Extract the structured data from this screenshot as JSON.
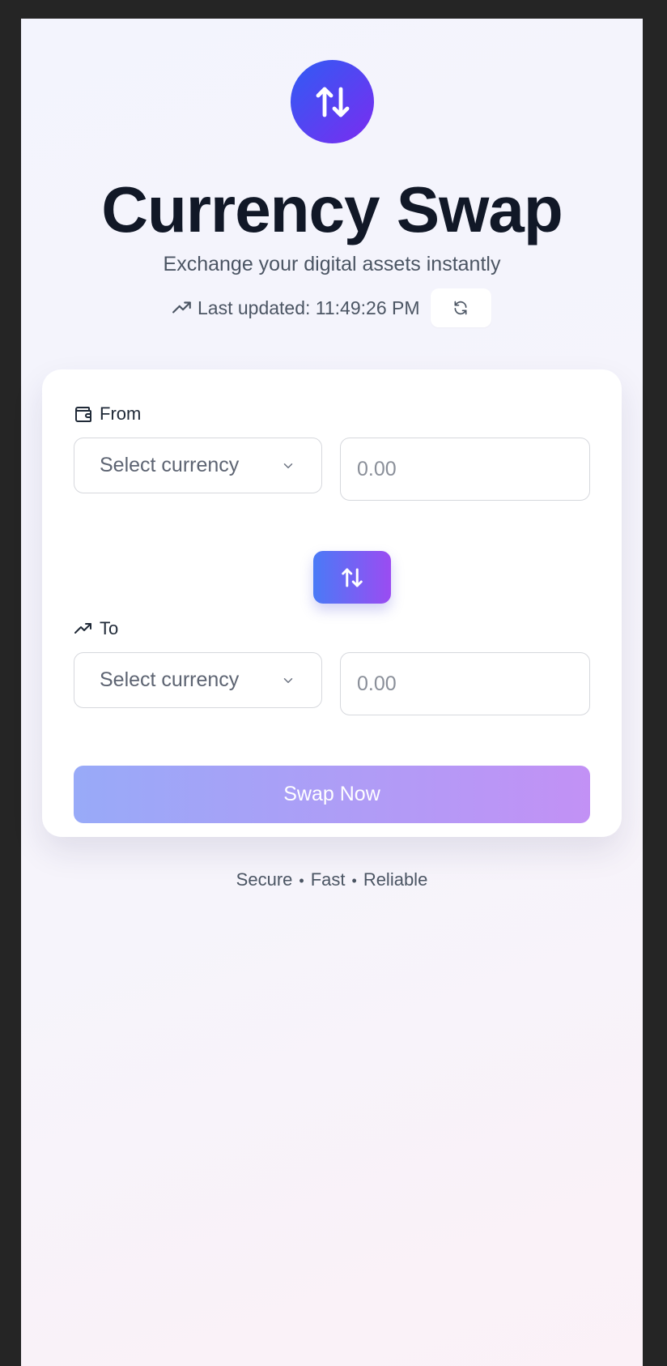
{
  "header": {
    "title": "Currency Swap",
    "subtitle": "Exchange your digital assets instantly",
    "last_updated": "Last updated: 11:49:26 PM"
  },
  "form": {
    "from": {
      "label": "From",
      "currency_select": "Select currency",
      "amount_placeholder": "0.00"
    },
    "to": {
      "label": "To",
      "currency_select": "Select currency",
      "amount_placeholder": "0.00"
    },
    "submit_label": "Swap Now"
  },
  "footer": {
    "tags": [
      "Secure",
      "Fast",
      "Reliable"
    ],
    "separator": "•"
  },
  "icons": {
    "logo": "arrow-up-down-icon",
    "last_updated": "trending-up-icon",
    "refresh": "refresh-icon",
    "from": "wallet-icon",
    "to": "trending-up-icon",
    "select": "chevron-down-icon",
    "direction": "arrow-up-down-icon"
  },
  "colors": {
    "accent_start": "#2f5cf4",
    "accent_end": "#7b2cf0",
    "title": "#111827",
    "text_secondary": "#4b5563"
  }
}
